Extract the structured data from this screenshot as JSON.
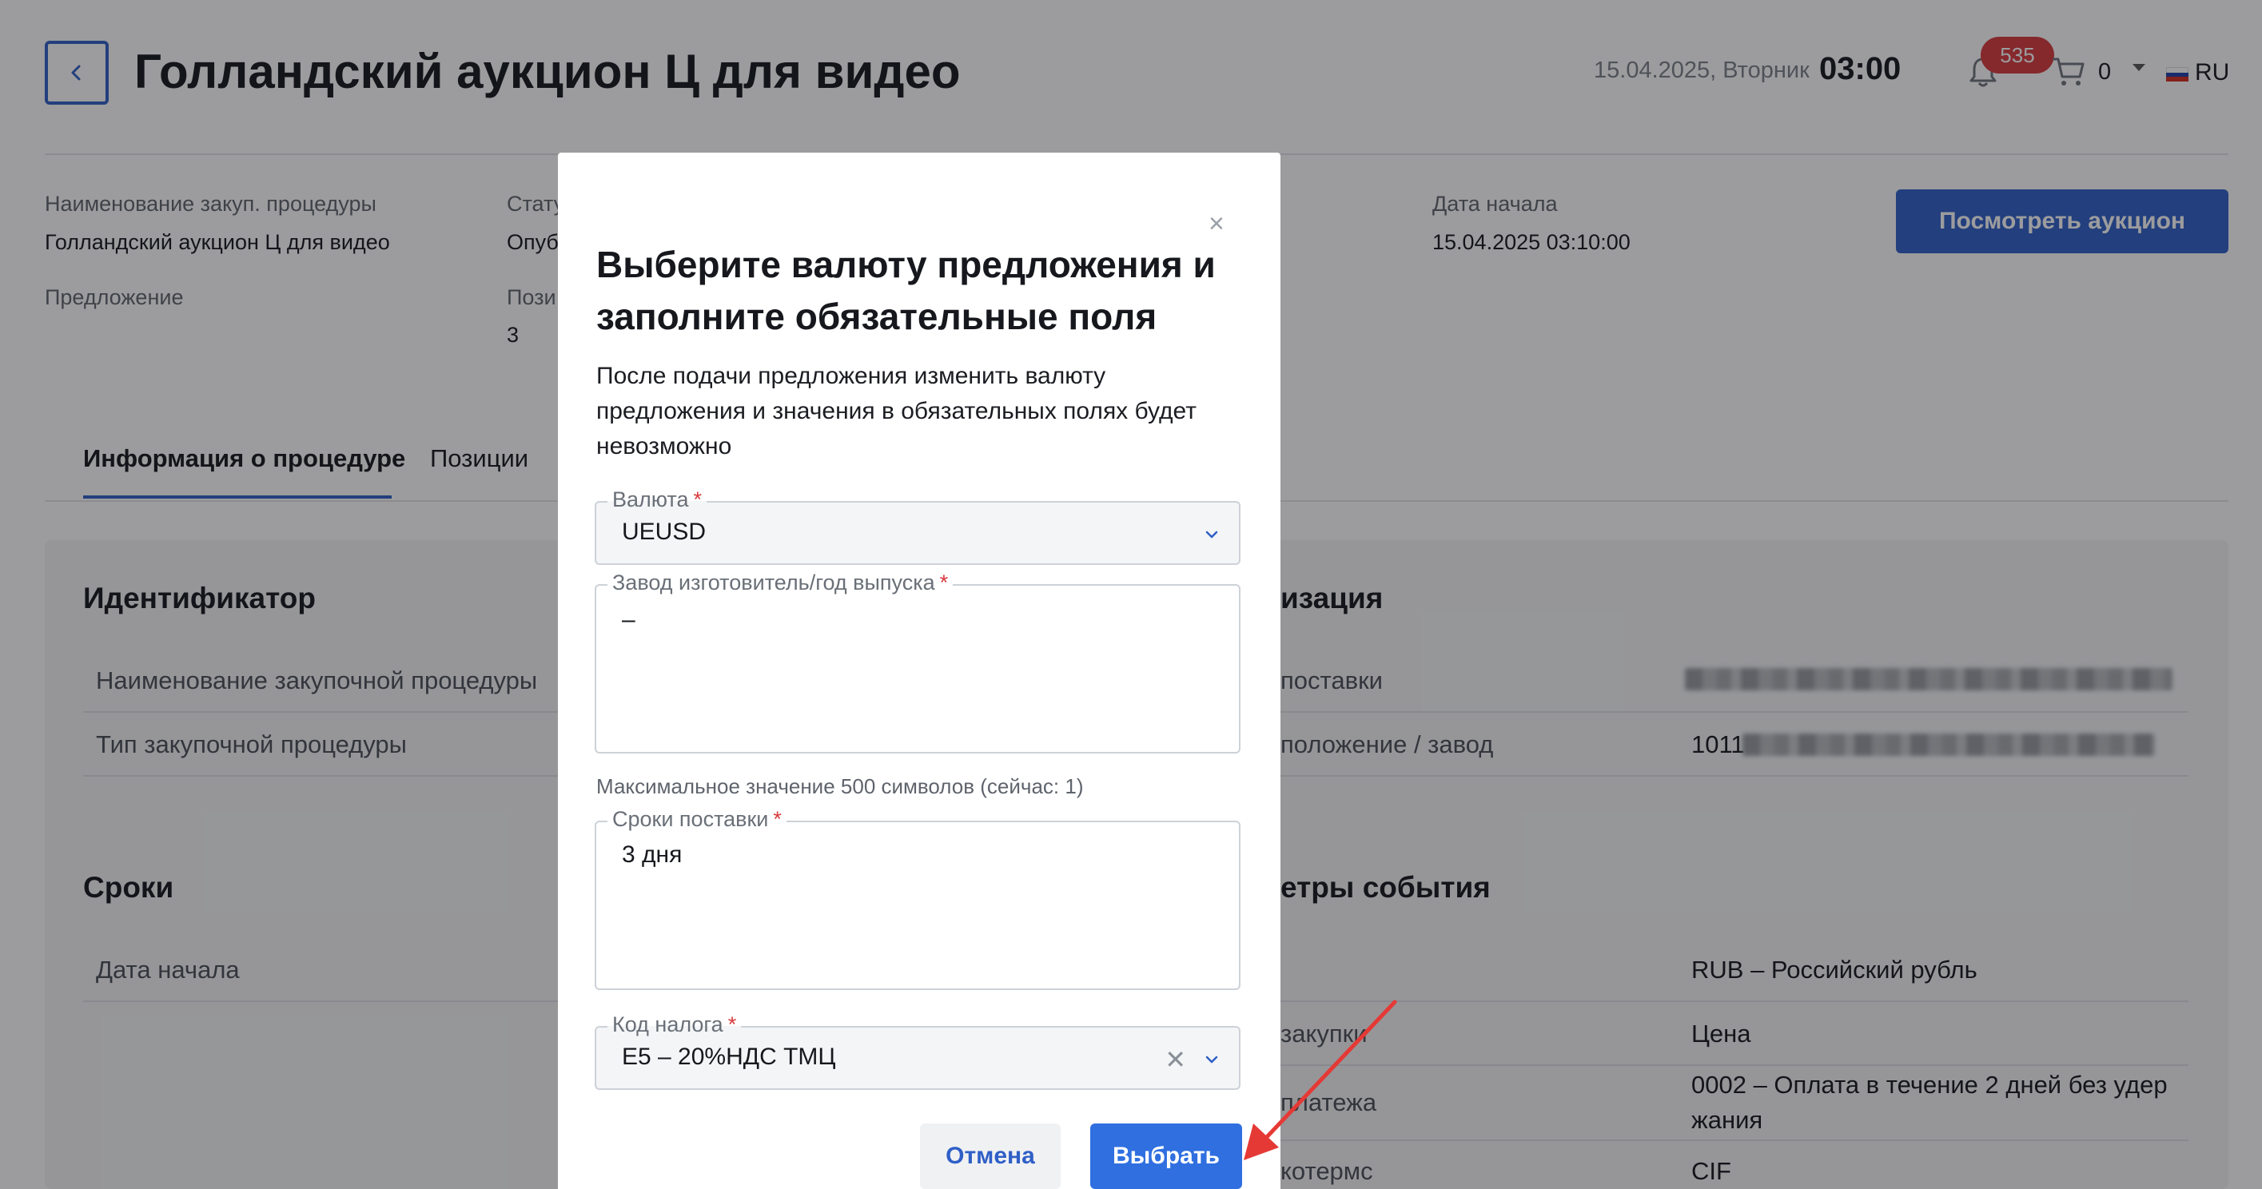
{
  "header": {
    "title": "Голландский аукцион Ц для видео",
    "date": "15.04.2025, Вторник",
    "time": "03:00",
    "notifications_count": "535",
    "cart_count": "0",
    "language": "RU"
  },
  "summary": {
    "procurement_name_label": "Наименование закуп. процедуры",
    "procurement_name_value": "Голландский аукцион Ц для видео",
    "status_label": "Стату",
    "status_value": "Опуб",
    "offer_label": "Предложение",
    "positions_label": "Пози",
    "positions_value": "3",
    "start_date_label": "Дата начала",
    "start_date_value": "15.04.2025 03:10:00",
    "view_auction_button": "Посмотреть аукцион"
  },
  "tabs": [
    {
      "label": "Информация о процедуре",
      "active": true
    },
    {
      "label": "Позиции",
      "active": false
    }
  ],
  "sections": {
    "identifier": {
      "title": "Идентификатор",
      "rows": [
        {
          "label": "Наименование закупочной процедуры"
        },
        {
          "label": "Тип закупочной процедуры"
        }
      ]
    },
    "org": {
      "title_partial": "изация",
      "rows": [
        {
          "label": "поставки"
        },
        {
          "label": "положение / завод",
          "value": "1011"
        }
      ]
    },
    "terms": {
      "title": "Сроки",
      "rows": [
        {
          "label": "Дата начала"
        }
      ]
    },
    "event": {
      "title_partial": "етры события",
      "rows": [
        {
          "label": "",
          "value": "RUB – Российский рубль"
        },
        {
          "label": "закупки",
          "value": "Цена"
        },
        {
          "label": "платежа",
          "value_line1": "0002 – Оплата в течение 2 дней без удер",
          "value_line2": "жания"
        },
        {
          "label": "котермс",
          "value": "CIF"
        }
      ]
    }
  },
  "modal": {
    "close_glyph": "×",
    "title": "Выберите валюту предложения и заполните обязательные поля",
    "description": "После подачи предложения изменить валюту предложения и значения в обязательных полях будет невозможно",
    "currency": {
      "label": "Валюта",
      "required_mark": "*",
      "value": "UEUSD"
    },
    "manufacturer": {
      "label": "Завод изготовитель/год выпуска",
      "required_mark": "*",
      "value": "–"
    },
    "hint": "Максимальное значение 500 символов (сейчас: 1)",
    "delivery": {
      "label": "Сроки поставки",
      "required_mark": "*",
      "value": "3 дня"
    },
    "tax": {
      "label": "Код налога",
      "required_mark": "*",
      "value": "E5 – 20%НДС ТМЦ",
      "clear_glyph": "✕"
    },
    "cancel_button": "Отмена",
    "select_button": "Выбрать"
  },
  "icons": {
    "back": "chevron-left-icon",
    "bell": "bell-icon",
    "cart": "cart-icon",
    "flag": "russia-flag-icon",
    "close": "close-icon",
    "chevron": "chevron-down-icon",
    "clear": "clear-icon"
  },
  "colors": {
    "brand_blue": "#2f5fc7",
    "primary_button": "#2f6fe0",
    "badge_red": "#d83a3d",
    "required_red": "#d83a3d",
    "annotation_arrow": "#e53935"
  }
}
